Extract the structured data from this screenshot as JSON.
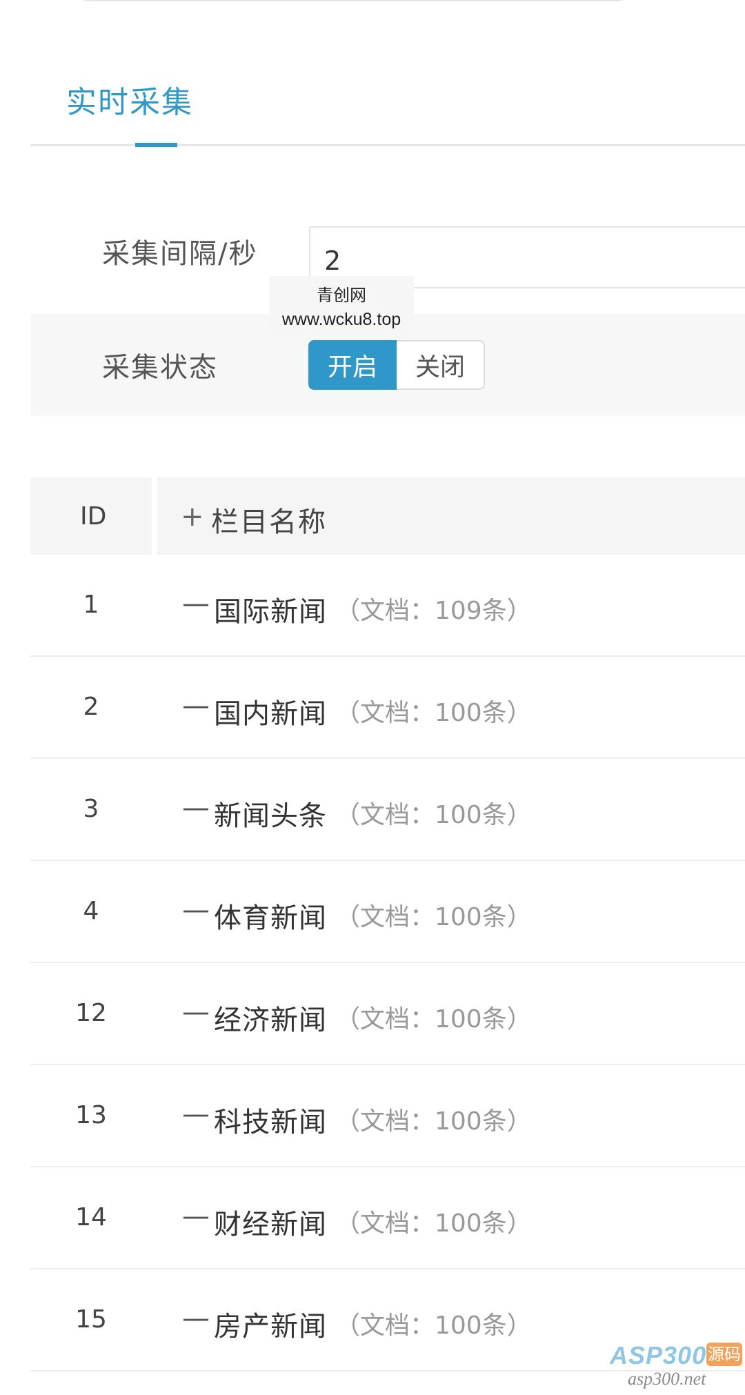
{
  "tabs": {
    "active": "实时采集"
  },
  "form": {
    "interval_label": "采集间隔/秒",
    "interval_value": "2",
    "status_label": "采集状态",
    "status_on": "开启",
    "status_off": "关闭"
  },
  "watermark": {
    "title": "青创网",
    "url": "www.wcku8.top"
  },
  "table": {
    "col_id": "ID",
    "col_name_icon": "+",
    "col_name": "栏目名称",
    "rows": [
      {
        "id": "1",
        "dash": "—",
        "name": "国际新闻",
        "count": "（文档：109条）"
      },
      {
        "id": "2",
        "dash": "—",
        "name": "国内新闻",
        "count": "（文档：100条）"
      },
      {
        "id": "3",
        "dash": "—",
        "name": "新闻头条",
        "count": "（文档：100条）"
      },
      {
        "id": "4",
        "dash": "—",
        "name": "体育新闻",
        "count": "（文档：100条）"
      },
      {
        "id": "12",
        "dash": "—",
        "name": "经济新闻",
        "count": "（文档：100条）"
      },
      {
        "id": "13",
        "dash": "—",
        "name": "科技新闻",
        "count": "（文档：100条）"
      },
      {
        "id": "14",
        "dash": "—",
        "name": "财经新闻",
        "count": "（文档：100条）"
      },
      {
        "id": "15",
        "dash": "—",
        "name": "房产新闻",
        "count": "（文档：100条）"
      }
    ]
  },
  "logo": {
    "main": "ASP300",
    "badge": "源码",
    "sub": "asp300.net"
  },
  "colors": {
    "accent": "#2f98c8",
    "muted": "#999999"
  }
}
